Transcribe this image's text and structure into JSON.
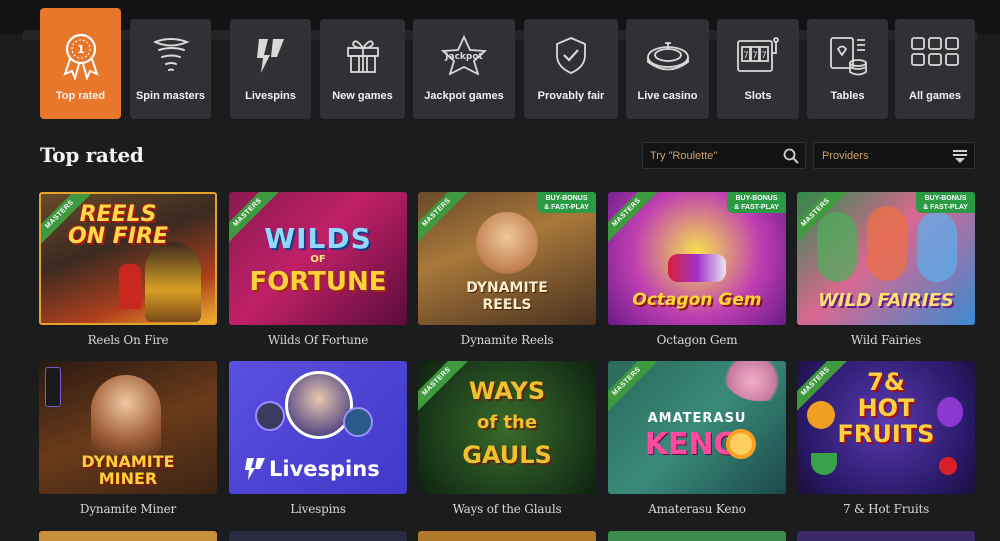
{
  "categories": [
    {
      "label": "Top rated",
      "icon": "award-ribbon-icon",
      "active": true
    },
    {
      "label": "Spin masters",
      "icon": "tornado-icon"
    },
    {
      "label": "Livespins",
      "icon": "livespins-bolt-icon"
    },
    {
      "label": "New games",
      "icon": "gift-box-icon"
    },
    {
      "label": "Jackpot games",
      "icon": "jackpot-star-icon"
    },
    {
      "label": "Provably fair",
      "icon": "shield-check-icon"
    },
    {
      "label": "Live casino",
      "icon": "roulette-wheel-icon"
    },
    {
      "label": "Slots",
      "icon": "slot-machine-icon"
    },
    {
      "label": "Tables",
      "icon": "cards-chips-icon"
    },
    {
      "label": "All games",
      "icon": "grid-icon"
    }
  ],
  "section": {
    "title": "Top rated"
  },
  "search": {
    "placeholder": "Try \"Roulette\""
  },
  "providers": {
    "label": "Providers"
  },
  "badges": {
    "masters": "MASTERS",
    "buy_line1": "BUY-BONUS",
    "buy_line2": "& FAST-PLAY"
  },
  "games": [
    {
      "name": "Reels On Fire",
      "logo_line1": "REELS",
      "logo_line2": "ON FIRE",
      "masters": true,
      "buy_bonus": false
    },
    {
      "name": "Wilds Of Fortune",
      "logo_line1": "WILDS",
      "logo_line2": "FORTUNE",
      "masters": true,
      "buy_bonus": false
    },
    {
      "name": "Dynamite Reels",
      "logo_line1": "DYNAMITE",
      "logo_line2": "REELS",
      "masters": true,
      "buy_bonus": true
    },
    {
      "name": "Octagon Gem",
      "logo_line1": "Octagon Gem",
      "masters": true,
      "buy_bonus": true
    },
    {
      "name": "Wild Fairies",
      "logo_line1": "WILD FAIRIES",
      "masters": true,
      "buy_bonus": true
    },
    {
      "name": "Dynamite Miner",
      "logo_line1": "DYNAMITE",
      "logo_line2": "MINER",
      "masters": false,
      "buy_bonus": false
    },
    {
      "name": "Livespins",
      "logo_line1": "Livespins",
      "masters": false,
      "buy_bonus": false
    },
    {
      "name": "Ways of the Glauls",
      "logo_line1": "WAYS",
      "logo_line2": "of the",
      "logo_line3": "GAULS",
      "masters": true,
      "buy_bonus": false
    },
    {
      "name": "Amaterasu Keno",
      "logo_line1": "AMATERASU",
      "logo_line2": "KENO",
      "masters": true,
      "buy_bonus": false
    },
    {
      "name": "7 & Hot Fruits",
      "logo_line1": "7&",
      "logo_line2": "HOT",
      "logo_line3": "FRUITS",
      "masters": true,
      "buy_bonus": false
    }
  ],
  "colors": {
    "accent": "#e8762b",
    "background": "#1b1c1e",
    "tile": "#2f3134",
    "masters_ribbon": "#3f9a3f"
  }
}
